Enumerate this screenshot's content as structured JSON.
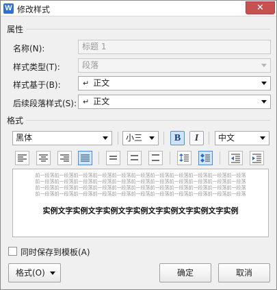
{
  "window": {
    "title": "修改样式",
    "app_icon_letter": "W",
    "close_glyph": "✕"
  },
  "attributes": {
    "section_label": "属性",
    "name_label": "名称(N):",
    "name_value": "标题 1",
    "type_label": "样式类型(T):",
    "type_value": "段落",
    "based_on_label": "样式基于(B):",
    "based_on_value": "正文",
    "next_label": "后续段落样式(S):",
    "next_value": "正文",
    "return_glyph": "↵"
  },
  "format": {
    "section_label": "格式",
    "font_name": "黑体",
    "font_size": "小三",
    "bold_label": "B",
    "italic_label": "I",
    "script": "中文",
    "icons": [
      "align-left-icon",
      "align-center-icon",
      "align-right-icon",
      "justify-icon",
      "line-spacing-single-icon",
      "line-spacing-1-5-icon",
      "line-spacing-double-icon",
      "spacing-before-icon",
      "spacing-after-icon",
      "decrease-indent-icon",
      "increase-indent-icon"
    ]
  },
  "preview": {
    "prev_paragraph_lines": [
      "前一段落前一段落前一段落前一段落前一段落前一段落前一段落前一段落前一段落前一段落前一段落",
      "前一段落前一段落前一段落前一段落前一段落前一段落前一段落前一段落前一段落前一段落前一段落",
      "前一段落前一段落前一段落前一段落前一段落前一段落前一段落前一段落前一段落前一段落前一段落",
      "前一段落前一段落前一段落前一段落前一段落前一段落前一段落前一段落前一段落前一段落前一段落"
    ],
    "sample_text": "实例文字实例文字实例文字实例文字实例文字实例文字实例"
  },
  "save_to_template_label": "同时保存到模板(A)",
  "buttons": {
    "format": "格式(O)",
    "ok": "确定",
    "cancel": "取消"
  }
}
